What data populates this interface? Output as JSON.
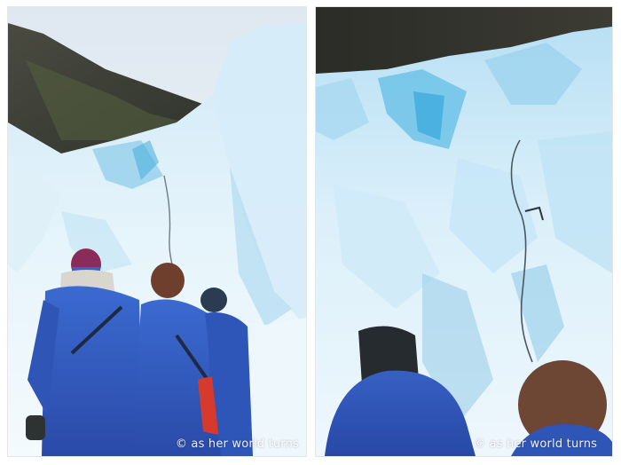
{
  "watermark": {
    "text": "© as her world turns"
  },
  "palette": {
    "ice_light": "#e8f4fb",
    "ice_mid": "#a9d7ef",
    "ice_deep": "#5cb7e0",
    "rock": "#3a3b33",
    "sky": "#e9f0f6",
    "jacket_blue": "#3055b8",
    "bag_red": "#d63a2d"
  }
}
